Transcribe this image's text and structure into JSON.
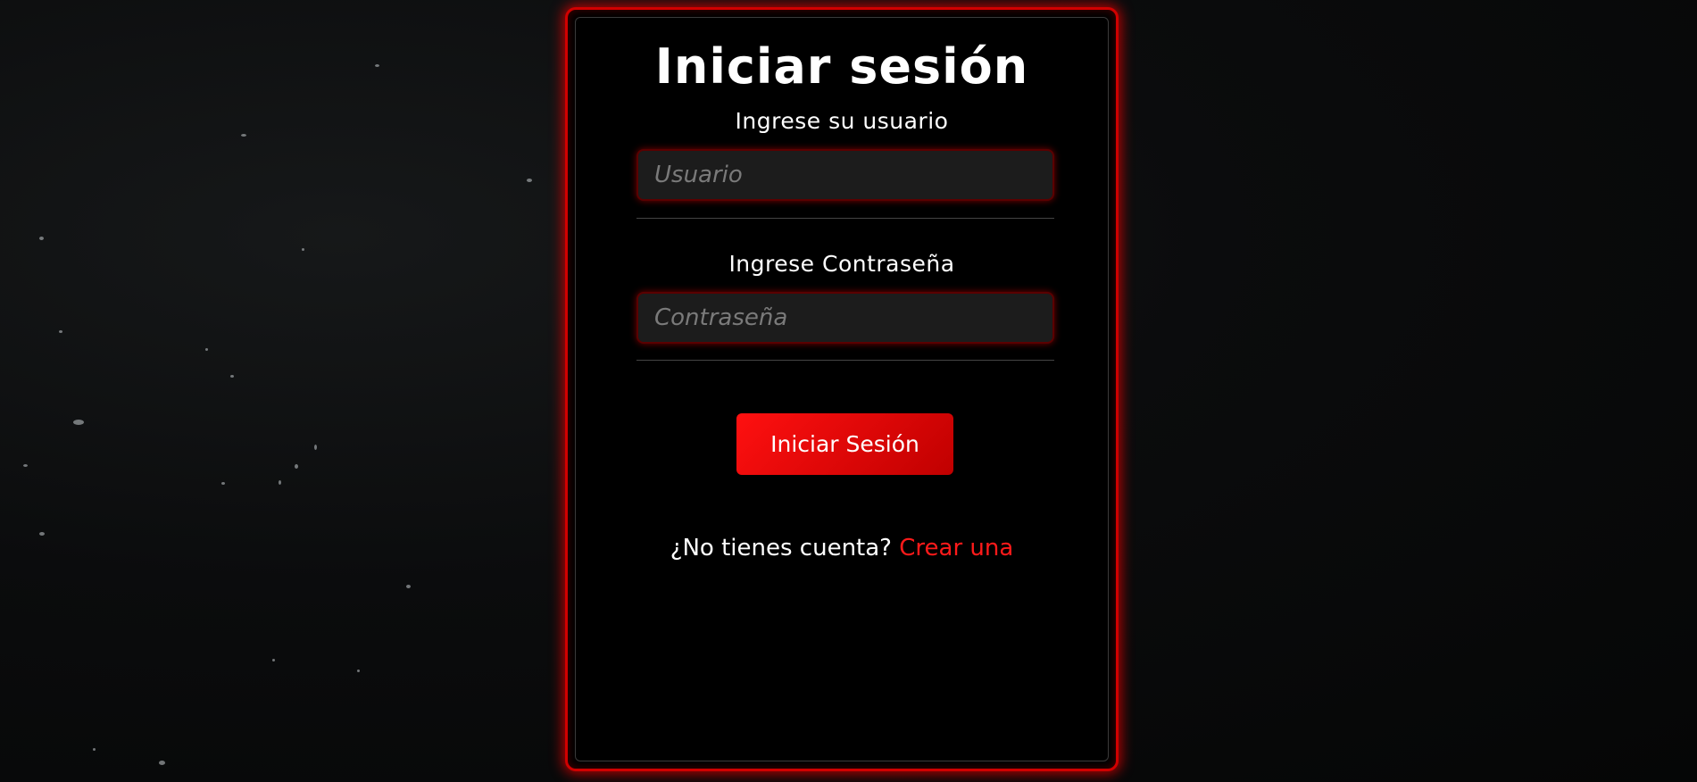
{
  "login": {
    "title": "Iniciar sesión",
    "username_label": "Ingrese su usuario",
    "username_placeholder": "Usuario",
    "password_label": "Ingrese Contraseña",
    "password_placeholder": "Contraseña",
    "submit_label": "Iniciar Sesión",
    "signup_prompt": "¿No tienes cuenta?",
    "signup_link": "Crear una"
  },
  "colors": {
    "accent": "#e00000",
    "background": "#0b0c0d",
    "card": "#000000"
  }
}
